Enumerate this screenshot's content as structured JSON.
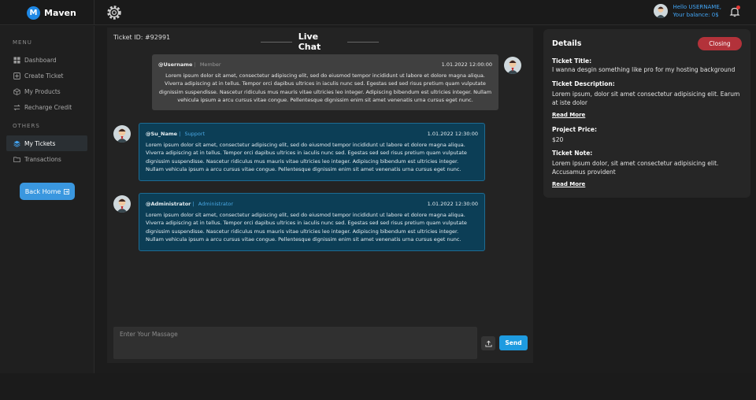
{
  "brand": {
    "logo_letter": "M",
    "name": "Maven"
  },
  "header": {
    "greeting": "Hello USERNAME,",
    "balance": "Your balance: 0$"
  },
  "sidebar": {
    "menu_label": "MENU",
    "others_label": "OTHERS",
    "menu_items": [
      {
        "label": "Dashboard",
        "icon": "dashboard-icon"
      },
      {
        "label": "Create Ticket",
        "icon": "plus-square-icon"
      },
      {
        "label": "My Products",
        "icon": "box-icon"
      },
      {
        "label": "Recharge Credit",
        "icon": "exchange-icon"
      }
    ],
    "other_items": [
      {
        "label": "My Tickets",
        "icon": "layers-icon",
        "active": true
      },
      {
        "label": "Transactions",
        "icon": "folder-icon"
      }
    ],
    "back_home": "Back Home"
  },
  "chat": {
    "ticket_id": "Ticket ID: #92991",
    "title": "Live Chat",
    "messages": [
      {
        "user": "@Username",
        "role": "Member",
        "date": "1.01.2022 12:00:00",
        "text": "Lorem ipsum dolor sit amet, consectetur adipiscing elit, sed do eiusmod tempor incididunt ut labore et dolore magna aliqua. Viverra adipiscing at in tellus. Tempor orci dapibus ultrices in iaculis nunc sed. Egestas sed sed risus pretium quam vulputate dignissim suspendisse. Nascetur ridiculus mus mauris vitae ultricies leo integer. Adipiscing bibendum est ultricies integer. Nullam vehicula ipsum a arcu cursus vitae congue. Pellentesque dignissim enim sit amet venenatis urna cursus eget nunc."
      },
      {
        "user": "@Su_Name",
        "role": "Support",
        "date": "1.01.2022 12:30:00",
        "text": "Lorem ipsum dolor sit amet, consectetur adipiscing elit, sed do eiusmod tempor incididunt ut labore et dolore magna aliqua. Viverra adipiscing at in tellus. Tempor orci dapibus ultrices in iaculis nunc sed. Egestas sed sed risus pretium quam vulputate dignissim suspendisse. Nascetur ridiculus mus mauris vitae ultricies leo integer. Adipiscing bibendum est ultricies integer. Nullam vehicula ipsum a arcu cursus vitae congue. Pellentesque dignissim enim sit amet venenatis urna cursus eget nunc."
      },
      {
        "user": "@Administrator",
        "role": "Administrator",
        "date": "1.01.2022 12:30:00",
        "text": "Lorem ipsum dolor sit amet, consectetur adipiscing elit, sed do eiusmod tempor incididunt ut labore et dolore magna aliqua. Viverra adipiscing at in tellus. Tempor orci dapibus ultrices in iaculis nunc sed. Egestas sed sed risus pretium quam vulputate dignissim suspendisse. Nascetur ridiculus mus mauris vitae ultricies leo integer. Adipiscing bibendum est ultricies integer. Nullam vehicula ipsum a arcu cursus vitae congue. Pellentesque dignissim enim sit amet venenatis urna cursus eget nunc."
      }
    ],
    "input_placeholder": "Enter Your Massage",
    "send_label": "Send"
  },
  "details": {
    "title": "Details",
    "status": "Closing",
    "ticket_title_label": "Ticket Title:",
    "ticket_title": "I wanna desgin something like pro for my hosting background",
    "description_label": "Ticket Description:",
    "description": "Lorem ipsum, dolor sit amet consectetur adipisicing elit. Earum at iste dolor",
    "read_more": "Read More",
    "price_label": "Project Price:",
    "price": "$20",
    "note_label": "Ticket Note:",
    "note": "Lorem ipsum dolor, sit amet consectetur adipisicing elit. Accusamus provident"
  },
  "colors": {
    "accent": "#1e9be0",
    "support_bubble": "#0c3e56",
    "member_bubble": "#404040",
    "closing_badge": "#b3323a"
  }
}
